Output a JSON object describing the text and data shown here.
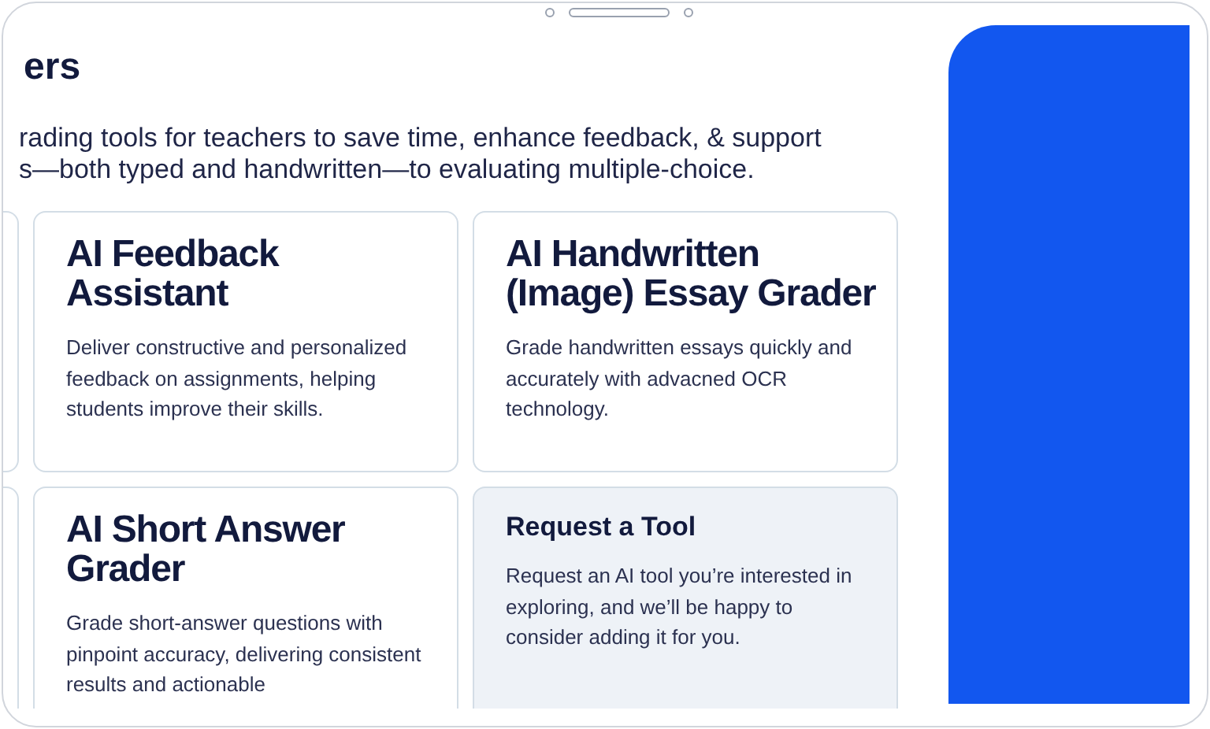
{
  "page": {
    "heading": "ers",
    "intro_lines": [
      "rading tools for teachers to save time, enhance feedback, & support",
      "s—both typed and handwritten—to evaluating multiple-choice."
    ]
  },
  "cards": [
    {
      "kind": "tool",
      "title": "AI Feedback Assistant",
      "description": "Deliver constructive and personalized feedback on assignments, helping students improve their skills."
    },
    {
      "kind": "tool",
      "title": "AI Handwritten (Image) Essay Grader",
      "description": "Grade handwritten essays quickly and accurately with advacned OCR technology."
    },
    {
      "kind": "tool",
      "title": "AI Short Answer Grader",
      "description": "Grade short-answer questions with pinpoint accuracy, delivering consistent results and actionable"
    },
    {
      "kind": "request",
      "title": "Request a Tool",
      "description": "Request an AI tool you’re interested in exploring, and we’ll be happy to consider adding it for you."
    }
  ]
}
